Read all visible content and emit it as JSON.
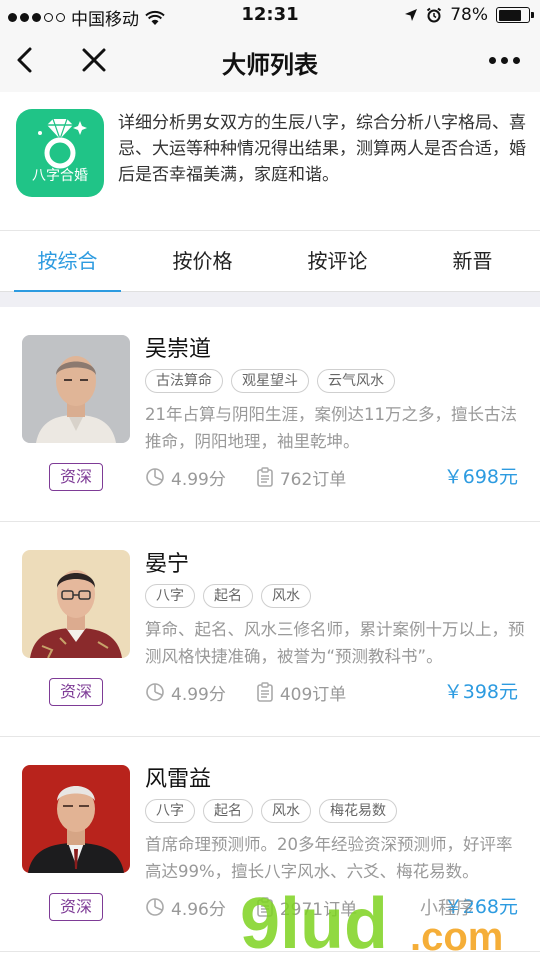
{
  "status_bar": {
    "carrier": "中国移动",
    "time": "12:31",
    "battery": "78%",
    "battery_level": 0.78
  },
  "nav": {
    "title": "大师列表"
  },
  "intro": {
    "app_icon_label": "八字合婚",
    "description": "详细分析男女双方的生辰八字，综合分析八字格局、喜忌、大运等种种情况得出结果，测算两人是否合适，婚后是否幸福美满，家庭和谐。"
  },
  "tabs": [
    {
      "label": "按综合",
      "active": true
    },
    {
      "label": "按价格",
      "active": false
    },
    {
      "label": "按评论",
      "active": false
    },
    {
      "label": "新晋",
      "active": false
    }
  ],
  "masters": [
    {
      "name": "吴崇道",
      "tags": [
        "古法算命",
        "观星望斗",
        "云气风水"
      ],
      "description": "21年占算与阴阳生涯，案例达11万之多，擅长古法推命，阴阳地理，袖里乾坤。",
      "badge": "资深",
      "rating": "4.99分",
      "orders": "762订单",
      "price": "￥698元"
    },
    {
      "name": "晏宁",
      "tags": [
        "八字",
        "起名",
        "风水"
      ],
      "description": "算命、起名、风水三修名师，累计案例十万以上，预测风格快捷准确，被誉为“预测教科书”。",
      "badge": "资深",
      "rating": "4.99分",
      "orders": "409订单",
      "price": "￥398元"
    },
    {
      "name": "风雷益",
      "tags": [
        "八字",
        "起名",
        "风水",
        "梅花易数"
      ],
      "description": "首席命理预测师。20多年经验资深预测师，好评率高达99%，擅长八字风水、六爻、梅花易数。",
      "badge": "资深",
      "rating": "4.96分",
      "orders": "2971订单",
      "price": "￥268元"
    }
  ],
  "watermark": {
    "text": "9lud.com",
    "sub": "小程序"
  },
  "colors": {
    "accent": "#2d9be0",
    "badge": "#7e3b96",
    "app_icon": "#20c487"
  }
}
